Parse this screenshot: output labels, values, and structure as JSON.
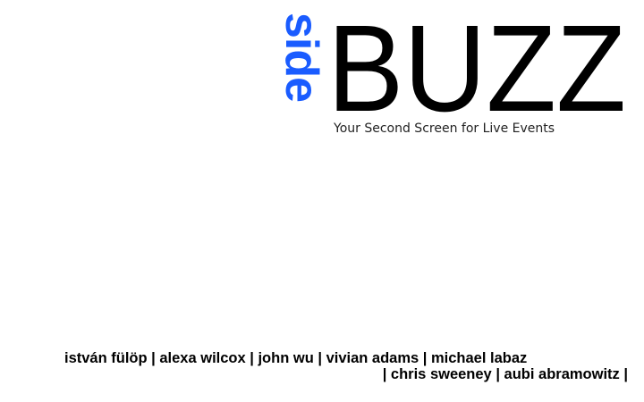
{
  "logo": {
    "side": "side",
    "buzz": "BUZZ",
    "side_color": "#1a5cff",
    "buzz_color": "#000000"
  },
  "tagline": "Your Second Screen for Live Events",
  "credits": {
    "line1": "istván fülöp | alexa wilcox | john wu | vivian adams | michael labaz",
    "line2": "| chris sweeney | aubi abramowitz |"
  }
}
